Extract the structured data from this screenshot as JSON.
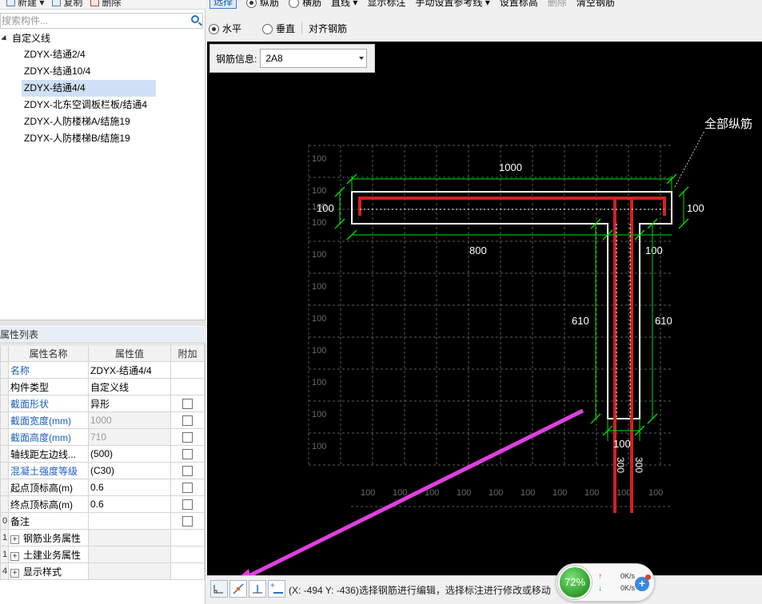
{
  "toolbar_left": {
    "new_label": "新建 ▾",
    "copy_label": "复制",
    "delete_label": "删除"
  },
  "search": {
    "placeholder": "搜索构件..."
  },
  "tree": {
    "root_label": "自定义线",
    "items": [
      {
        "label": "ZDYX-结通2/4",
        "selected": false
      },
      {
        "label": "ZDYX-结通10/4",
        "selected": false
      },
      {
        "label": "ZDYX-结通4/4",
        "selected": true
      },
      {
        "label": "ZDYX-北东空调板栏板/结通4",
        "selected": false
      },
      {
        "label": "ZDYX-人防楼梯A/结施19",
        "selected": false
      },
      {
        "label": "ZDYX-人防楼梯B/结施19",
        "selected": false
      }
    ]
  },
  "properties": {
    "title": "属性列表",
    "columns": [
      "属性名称",
      "属性值",
      "附加"
    ],
    "rows": [
      {
        "idx": "",
        "name": "名称",
        "value": "ZDYX-结通4/4",
        "blue": true,
        "grey": false,
        "check": false
      },
      {
        "idx": "",
        "name": "构件类型",
        "value": "自定义线",
        "blue": false,
        "grey": false,
        "check": false
      },
      {
        "idx": "",
        "name": "截面形状",
        "value": "异形",
        "blue": true,
        "grey": false,
        "check": true
      },
      {
        "idx": "",
        "name": "截面宽度(mm)",
        "value": "1000",
        "blue": true,
        "grey": true,
        "check": true
      },
      {
        "idx": "",
        "name": "截面高度(mm)",
        "value": "710",
        "blue": true,
        "grey": true,
        "check": true
      },
      {
        "idx": "",
        "name": "轴线距左边线...",
        "value": "(500)",
        "blue": false,
        "grey": false,
        "check": true
      },
      {
        "idx": "",
        "name": "混凝土强度等级",
        "value": "(C30)",
        "blue": true,
        "grey": false,
        "check": true
      },
      {
        "idx": "",
        "name": "起点顶标高(m)",
        "value": "0.6",
        "blue": false,
        "grey": false,
        "check": true
      },
      {
        "idx": "",
        "name": "终点顶标高(m)",
        "value": "0.6",
        "blue": false,
        "grey": false,
        "check": true
      },
      {
        "idx": "0",
        "name": "备注",
        "value": "",
        "blue": false,
        "grey": false,
        "check": true
      }
    ],
    "groups": [
      {
        "idx": "1",
        "label": "钢筋业务属性"
      },
      {
        "idx": "1",
        "label": "土建业务属性"
      },
      {
        "idx": "4",
        "label": "显示样式"
      }
    ]
  },
  "right_toolbar": {
    "select_label": "选择",
    "longitudinal_label": "纵筋",
    "transverse_label": "横筋",
    "line_label": "直线 ▾",
    "show_dim_label": "显示标注",
    "manual_ref_label": "手动设置参考线 ▾",
    "set_elev_label": "设置标高",
    "delete_label": "删除",
    "clear_label": "清空钢筋",
    "horizontal_label": "水平",
    "vertical_label": "垂直",
    "align_label": "对齐钢筋"
  },
  "rebar_info": {
    "label": "钢筋信息:",
    "value": "2A8"
  },
  "drawing": {
    "callout": "全部纵筋",
    "dims": {
      "top_width": "1000",
      "left_thick": "100",
      "right_thick": "100",
      "bottom_left": "800",
      "bottom_right": "100",
      "leg_left": "610",
      "leg_right": "610",
      "leg_bottom": "100",
      "rot1": "300",
      "rot2": "300"
    },
    "grid_label": "100",
    "colors": {
      "rebar": "#d42020",
      "outline": "#ffffff",
      "dim": "#00e000",
      "grid": "#5a5a5a",
      "arrow": "#e040e0"
    }
  },
  "statusbar": {
    "text": "(X: -494 Y: -436)选择钢筋进行编辑，选择标注进行修改或移动",
    "percent": "72%",
    "up": "0K/s",
    "down": "0K/s"
  }
}
